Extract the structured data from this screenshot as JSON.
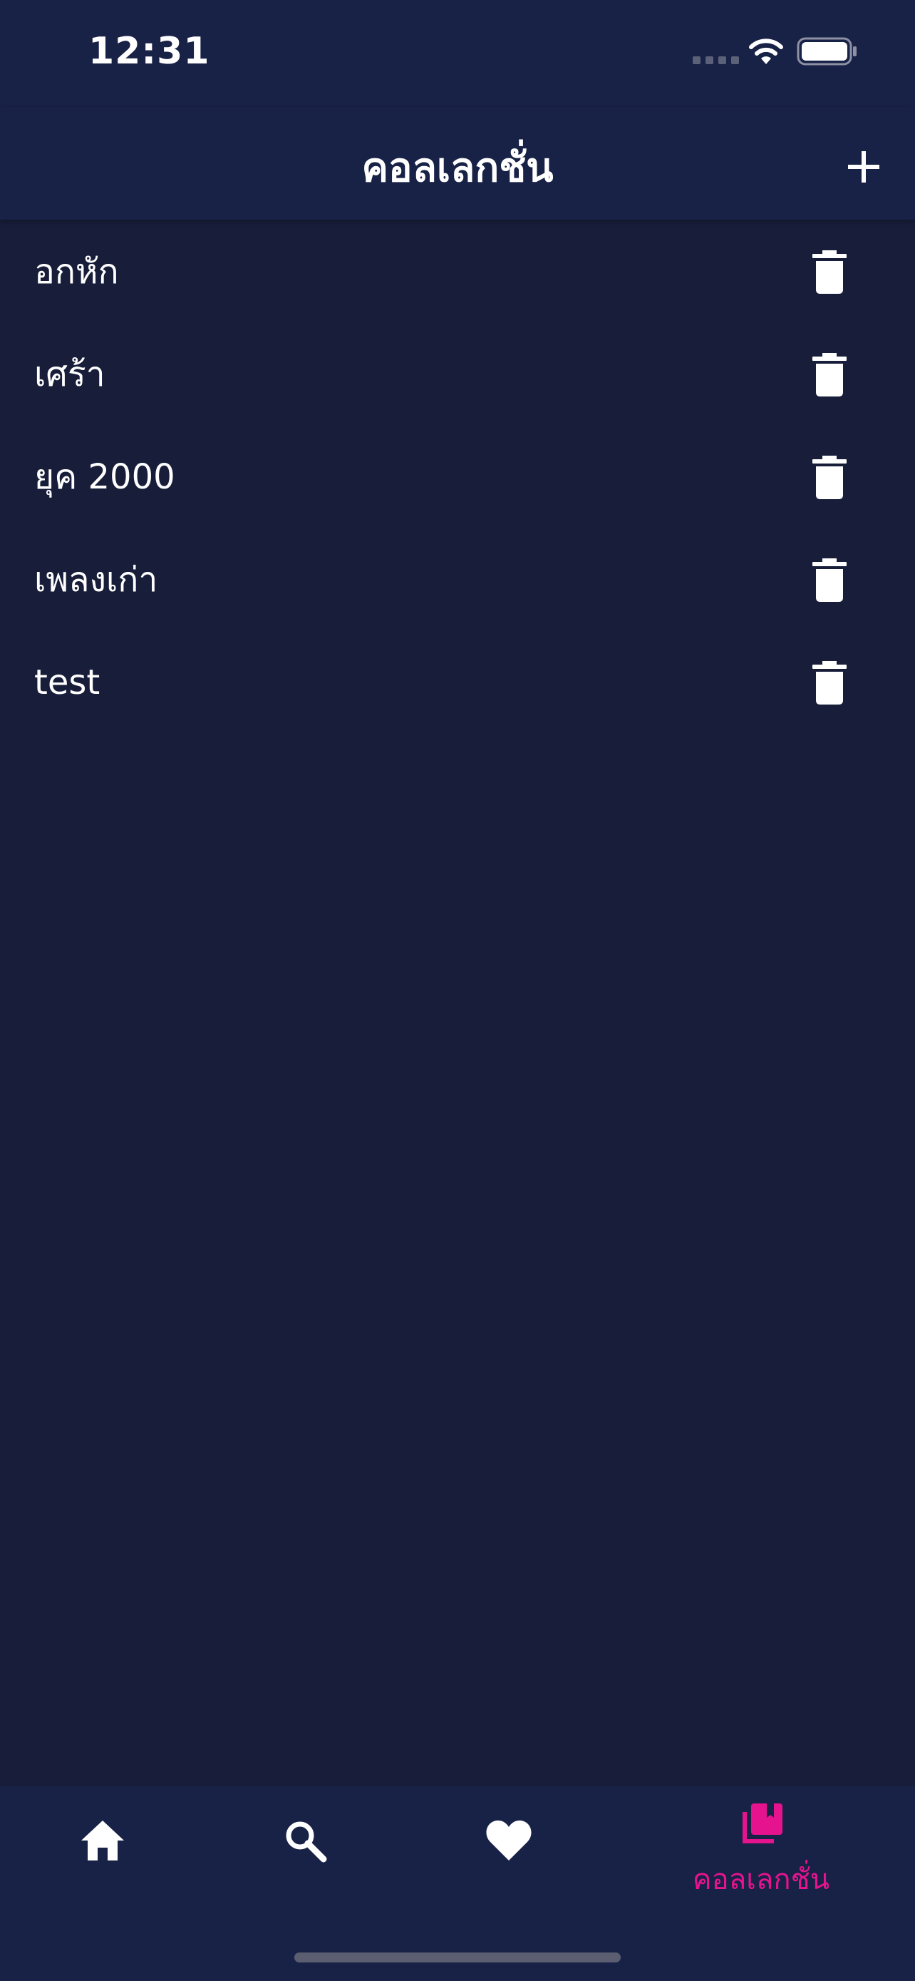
{
  "status_bar": {
    "time": "12:31"
  },
  "header": {
    "title": "คอลเลกชั่น",
    "add_icon": "plus-icon"
  },
  "collections": [
    {
      "name": "อกหัก"
    },
    {
      "name": "เศร้า"
    },
    {
      "name": "ยุค 2000"
    },
    {
      "name": "เพลงเก่า"
    },
    {
      "name": "test"
    }
  ],
  "tab_bar": {
    "tabs": [
      {
        "icon": "home-icon",
        "label": ""
      },
      {
        "icon": "search-icon",
        "label": ""
      },
      {
        "icon": "heart-icon",
        "label": ""
      },
      {
        "icon": "collections-icon",
        "label": "คอลเลกชั่น",
        "active": true
      }
    ]
  },
  "colors": {
    "background": "#181e3a",
    "bar_background": "#182146",
    "accent": "#e5148e",
    "text": "#ffffff"
  }
}
